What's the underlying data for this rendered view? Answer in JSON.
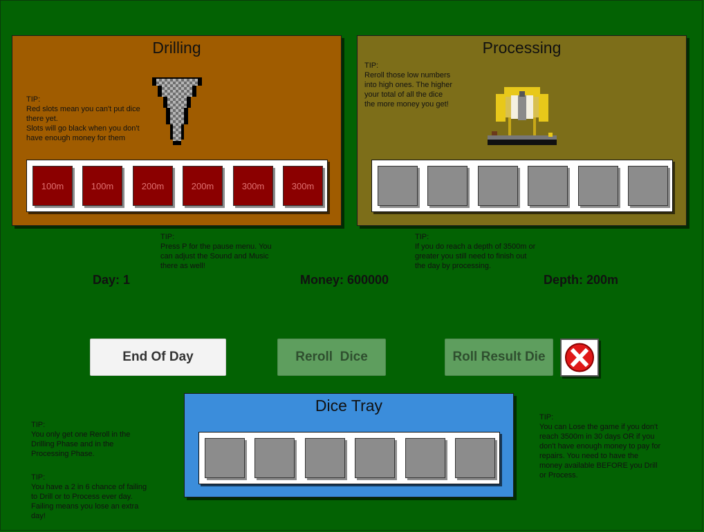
{
  "colors": {
    "background": "#036203",
    "drilling_panel": "#a05c00",
    "processing_panel": "#7d6e19",
    "dice_tray_panel": "#3b8ddb",
    "locked_slot": "#8b0000",
    "empty_slot": "#8c8c8c"
  },
  "drilling": {
    "title": "Drilling",
    "tip": "TIP:\nRed slots mean you can't put dice\nthere yet.\nSlots will go black when you don't\nhave enough money for them",
    "slots": [
      "100m",
      "100m",
      "200m",
      "200m",
      "300m",
      "300m"
    ]
  },
  "processing": {
    "title": "Processing",
    "tip": "TIP:\nReroll those low numbers\ninto high ones. The higher\nyour total of all the dice\nthe more money you get!"
  },
  "tips": {
    "pause": "TIP:\nPress P for the pause menu. You\ncan adjust the Sound and Music\nthere as well!",
    "depth": "TIP:\nIf you do reach a depth of 3500m or\ngreater you still need to finish out\nthe day by processing.",
    "reroll": "TIP:\nYou only get one Reroll in the\nDrilling Phase and in the\nProcessing Phase.",
    "fail": "TIP:\nYou have a 2 in 6 chance of failing\nto Drill or to Process ever day.\nFailing means you lose an extra\nday!",
    "lose": "TIP:\nYou can Lose the game if you don't\nreach 3500m in 30 days OR if you\ndon't have enough money to pay for\nrepairs. You need to have the\nmoney available BEFORE you Drill\nor Process."
  },
  "stats": {
    "day": "Day: 1",
    "money": "Money: 600000",
    "depth": "Depth: 200m"
  },
  "buttons": {
    "end_of_day": "End Of Day",
    "reroll_dice": "Reroll  Dice",
    "roll_result_die": "Roll Result Die"
  },
  "dice_tray": {
    "title": "Dice Tray"
  }
}
